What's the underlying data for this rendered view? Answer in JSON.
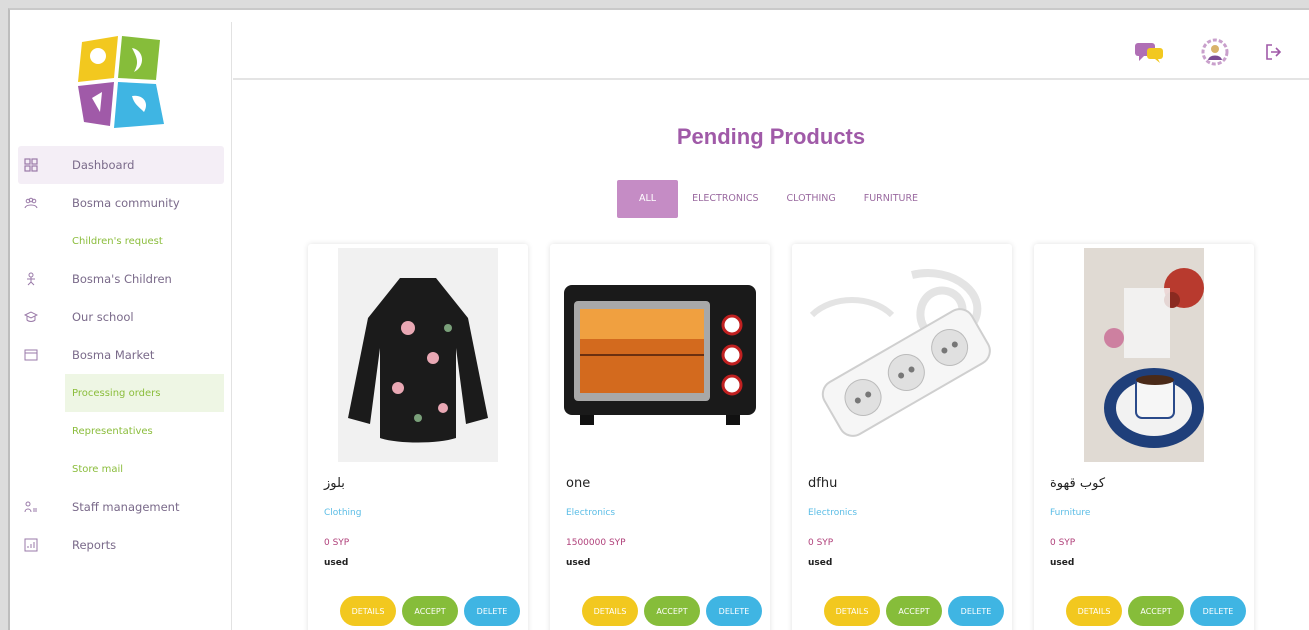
{
  "colors": {
    "accent": "#a05aa8",
    "filter_active": "#c58cc5",
    "sub_link": "#8bbd3c",
    "category": "#5bbde6",
    "price": "#b0407a",
    "details_btn": "#f2c81f",
    "accept_btn": "#86bd3a",
    "delete_btn": "#3fb5e3"
  },
  "sidebar": {
    "logo_icon": "bosma-logo",
    "items": [
      {
        "label": "Dashboard",
        "icon": "dashboard-icon",
        "active": true
      },
      {
        "label": "Bosma community",
        "icon": "community-icon"
      },
      {
        "label": "Children's request",
        "sub": true
      },
      {
        "label": "Bosma's Children",
        "icon": "child-icon"
      },
      {
        "label": "Our school",
        "icon": "school-icon"
      },
      {
        "label": "Bosma Market",
        "icon": "market-icon"
      },
      {
        "label": "Processing orders",
        "sub": true,
        "highlight": true
      },
      {
        "label": "Representatives",
        "sub": true
      },
      {
        "label": "Store mail",
        "sub": true
      },
      {
        "label": "Staff management",
        "icon": "staff-icon"
      },
      {
        "label": "Reports",
        "icon": "reports-icon"
      }
    ]
  },
  "topbar": {
    "icons": [
      "chat-icon",
      "profile-settings-icon",
      "logout-icon"
    ]
  },
  "page": {
    "title": "Pending Products"
  },
  "filters": [
    "ALL",
    "ELECTRONICS",
    "CLOTHING",
    "FURNITURE"
  ],
  "products": [
    {
      "name": "بلوز",
      "category": "Clothing",
      "price": "0 SYP",
      "condition": "used",
      "image_icon": "blouse-image"
    },
    {
      "name": "one",
      "category": "Electronics",
      "price": "1500000 SYP",
      "condition": "used",
      "image_icon": "oven-image"
    },
    {
      "name": "dfhu",
      "category": "Electronics",
      "price": "0 SYP",
      "condition": "used",
      "image_icon": "power-strip-image"
    },
    {
      "name": "كوب قهوة",
      "category": "Furniture",
      "price": "0 SYP",
      "condition": "used",
      "image_icon": "coffee-cup-image"
    }
  ],
  "actions": {
    "details": "DETAILS",
    "accept": "ACCEPT",
    "delete": "DELETE"
  }
}
